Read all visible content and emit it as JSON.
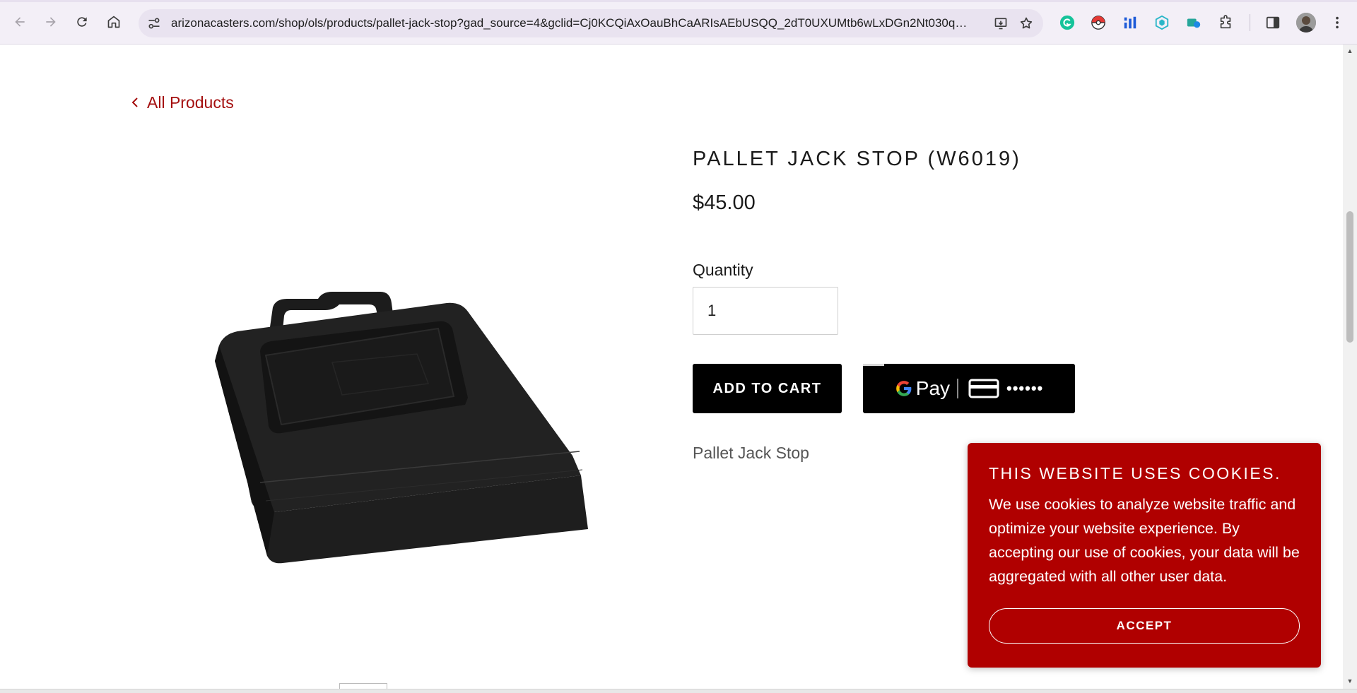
{
  "browser": {
    "url": "arizonacasters.com/shop/ols/products/pallet-jack-stop?gad_source=4&gclid=Cj0KCQiAxOauBhCaARIsAEbUSQQ_2dT0UXUMtb6wLxDGn2Nt030q4...",
    "icons": {
      "back": "back-arrow-icon",
      "forward": "forward-arrow-icon",
      "reload": "reload-icon",
      "home": "home-icon",
      "site_info": "tune-icon",
      "install": "install-app-icon",
      "bookmark": "star-icon",
      "extensions": [
        "grammarly-icon",
        "pokeball-icon",
        "bar-chart-icon",
        "shield-icon",
        "map-icon",
        "puzzle-icon"
      ],
      "side_panel": "side-panel-icon",
      "profile": "avatar",
      "menu": "kebab-menu-icon"
    }
  },
  "page": {
    "back_link": "All Products",
    "product": {
      "title": "PALLET JACK STOP (W6019)",
      "price": "$45.00",
      "quantity_label": "Quantity",
      "quantity_value": "1",
      "add_to_cart": "ADD TO CART",
      "gpay_label": "Pay",
      "gpay_card_mask": "••••••",
      "description": "Pallet Jack Stop"
    }
  },
  "cookie_banner": {
    "title": "THIS WEBSITE USES COOKIES.",
    "body": "We use cookies to analyze website traffic and optimize your website experience. By accepting our use of cookies, your data will be aggregated with all other user data.",
    "accept": "ACCEPT"
  },
  "colors": {
    "accent_red": "#a40e0e",
    "banner_red": "#b00000",
    "button_black": "#000000"
  }
}
